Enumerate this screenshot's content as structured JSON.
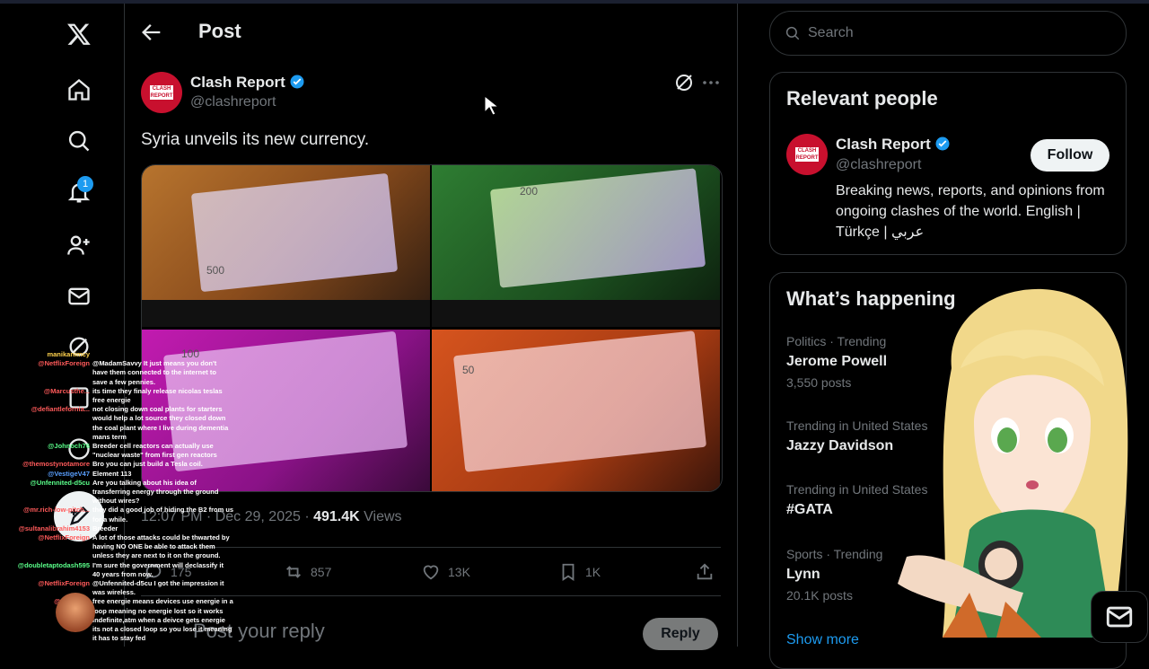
{
  "header": {
    "title": "Post"
  },
  "nav": {
    "notifications_badge": "1"
  },
  "post": {
    "author_name": "Clash Report",
    "author_handle": "@clashreport",
    "avatar_text": "CLASH REPORT",
    "text": "Syria unveils its new currency.",
    "time": "12:07 PM · Dec 29, 2025 · ",
    "views_count": "491.4K",
    "views_label": " Views",
    "notes": [
      "500",
      "200",
      "100",
      "50"
    ],
    "actions": {
      "replies": "175",
      "reposts": "857",
      "likes": "13K",
      "bookmarks": "1K"
    },
    "reply_placeholder": "Post your reply",
    "reply_button": "Reply"
  },
  "search": {
    "placeholder": "Search"
  },
  "relevant": {
    "title": "Relevant people",
    "name": "Clash Report",
    "handle": "@clashreport",
    "follow": "Follow",
    "bio": "Breaking news, reports, and opinions from ongoing clashes of the world. English | Türkçe | عربي"
  },
  "happening": {
    "title": "What’s happening",
    "trends": [
      {
        "context": "Politics · Trending",
        "name": "Jerome Powell",
        "count": "3,550 posts"
      },
      {
        "context": "Trending in United States",
        "name": "Jazzy Davidson",
        "count": ""
      },
      {
        "context": "Trending in United States",
        "name": "#GATA",
        "count": ""
      },
      {
        "context": "Sports · Trending",
        "name": "Lynn",
        "count": "20.1K posts"
      }
    ],
    "show_more": "Show more"
  },
  "chat": [
    {
      "user": "manikanimcy",
      "color": "#ffd24d",
      "msg": ""
    },
    {
      "user": "@NetflixForeign",
      "color": "#ff5a5a",
      "msg": "@MadamSavvy It just means you don't"
    },
    {
      "user": "",
      "color": "#ffffff",
      "msg": "have them connected to the internet to"
    },
    {
      "user": "",
      "color": "#ffffff",
      "msg": "save a few pennies."
    },
    {
      "user": "@Marcusthe...",
      "color": "#ff5a5a",
      "msg": "its time they finaly release nicolas teslas"
    },
    {
      "user": "",
      "color": "#ffffff",
      "msg": "free energie"
    },
    {
      "user": "@defiantlefornia...",
      "color": "#ff5a5a",
      "msg": "not closing down coal plants for starters"
    },
    {
      "user": "",
      "color": "#ffffff",
      "msg": "would help a lot source they closed down"
    },
    {
      "user": "",
      "color": "#ffffff",
      "msg": "the coal plant where I live during dementia"
    },
    {
      "user": "",
      "color": "#ffffff",
      "msg": "mans term"
    },
    {
      "user": "@Johnoch76",
      "color": "#5aff8a",
      "msg": "Breeder cell reactors can actually use"
    },
    {
      "user": "",
      "color": "#ffffff",
      "msg": "\"nuclear waste\" from first gen reactors"
    },
    {
      "user": "@themostynotamore",
      "color": "#ff5a5a",
      "msg": "Bro you can just build a Tesla coil."
    },
    {
      "user": "@VestigeV47",
      "color": "#5aa0ff",
      "msg": "Element 113"
    },
    {
      "user": "@Unfennited-d5cu",
      "color": "#5aff8a",
      "msg": "Are you talking about his idea of"
    },
    {
      "user": "",
      "color": "#ffffff",
      "msg": "transferring energy through the ground"
    },
    {
      "user": "",
      "color": "#ffffff",
      "msg": "without wires?"
    },
    {
      "user": "@mr.rich-low-pitch...",
      "color": "#ff5a5a",
      "msg": "they did a good job of hiding the B2 from us"
    },
    {
      "user": "",
      "color": "#ffffff",
      "msg": "for a while."
    },
    {
      "user": "@sultanalibrahim4153",
      "color": "#ff5a5a",
      "msg": "Breeder"
    },
    {
      "user": "@NetflixForeign",
      "color": "#ff5a5a",
      "msg": "A lot of those attacks could be thwarted by"
    },
    {
      "user": "",
      "color": "#ffffff",
      "msg": "having NO ONE be able to attack them"
    },
    {
      "user": "",
      "color": "#ffffff",
      "msg": "unless they are next to it on the ground."
    },
    {
      "user": "@doubletaptodash595",
      "color": "#5aff8a",
      "msg": "I'm sure the government will declassify it"
    },
    {
      "user": "",
      "color": "#ffffff",
      "msg": "40 years from now."
    },
    {
      "user": "@NetflixForeign",
      "color": "#ff5a5a",
      "msg": "@Unfennited-d5cu I got the impression it"
    },
    {
      "user": "",
      "color": "#ffffff",
      "msg": "was wireless."
    },
    {
      "user": "@Marcus...",
      "color": "#ff5a5a",
      "msg": "free energie means devices use energie in a"
    },
    {
      "user": "",
      "color": "#ffffff",
      "msg": "loop meaning no energie lost so it works"
    },
    {
      "user": "",
      "color": "#ffffff",
      "msg": "indefinite,atm when a deivce gets energie"
    },
    {
      "user": "",
      "color": "#ffffff",
      "msg": "its not a closed loop so you lose it meaning"
    },
    {
      "user": "",
      "color": "#ffffff",
      "msg": "it has to stay fed"
    }
  ]
}
